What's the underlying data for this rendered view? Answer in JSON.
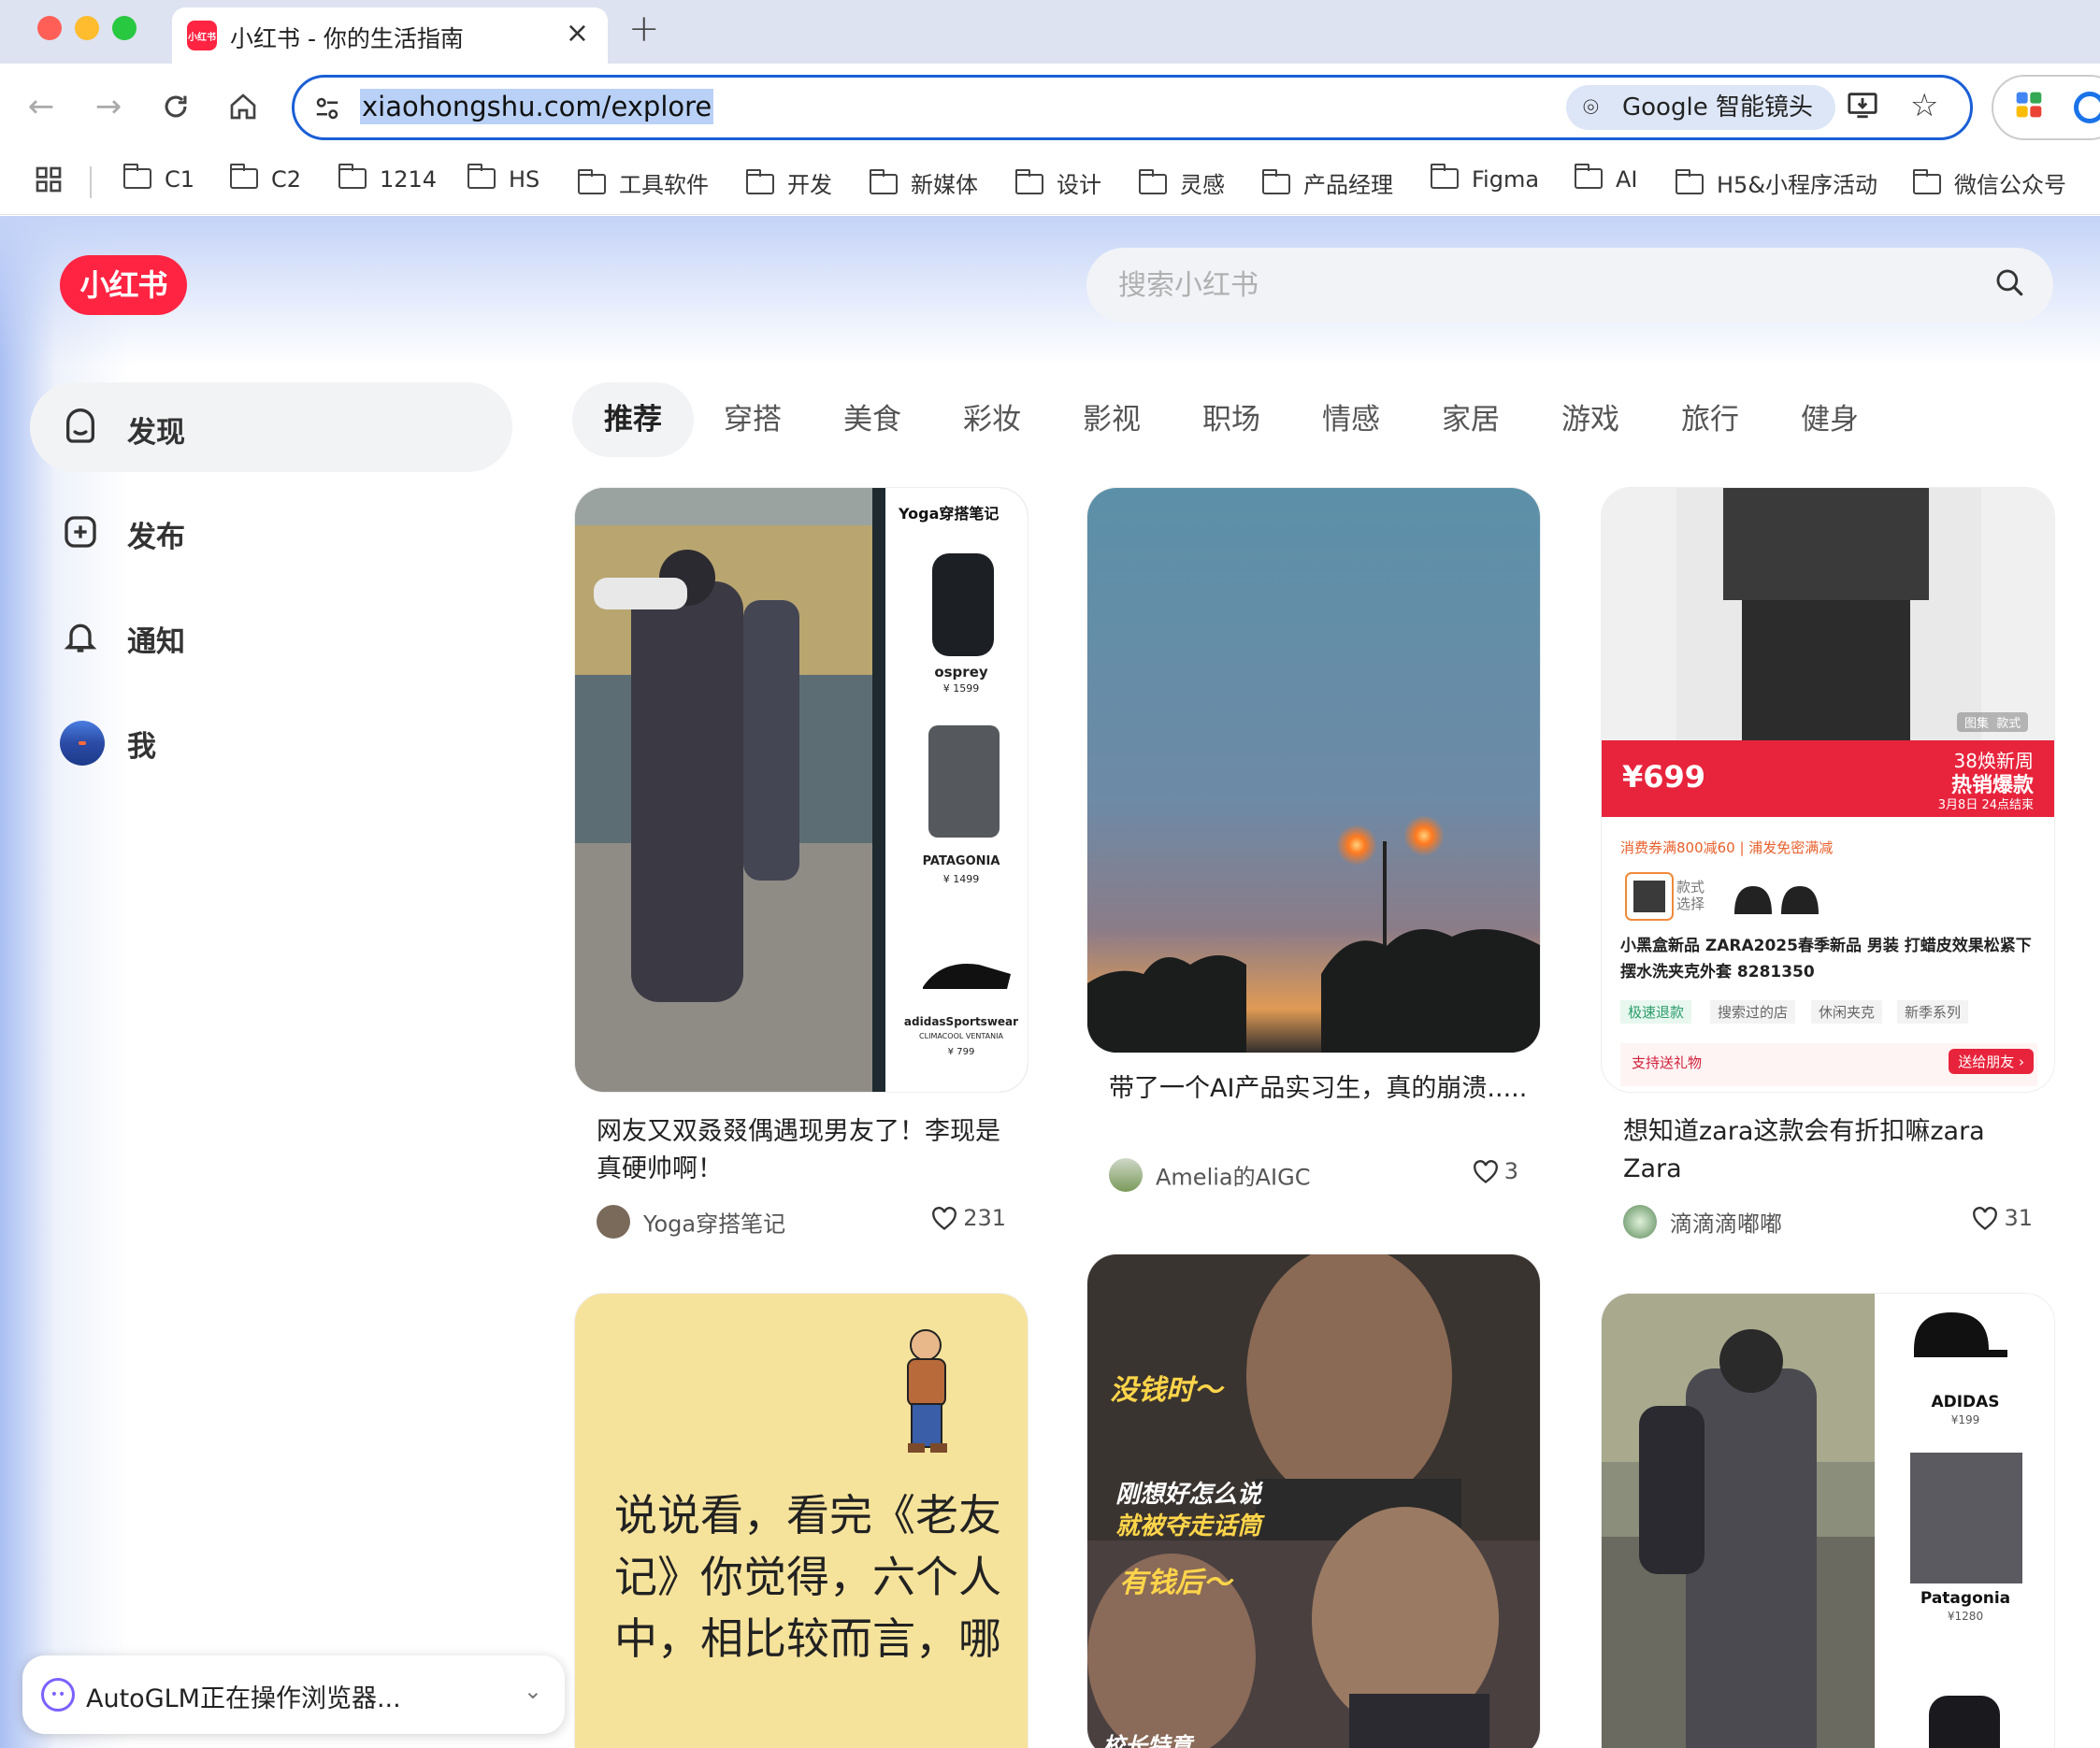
{
  "browser": {
    "tab_title": "小红书 - 你的生活指南",
    "tab_favicon_text": "小红书",
    "url": "xiaohongshu.com/explore",
    "lens_label": "Google 智能镜头",
    "bookmarks": [
      "C1",
      "C2",
      "1214",
      "HS",
      "工具软件",
      "开发",
      "新媒体",
      "设计",
      "灵感",
      "产品经理",
      "Figma",
      "AI",
      "H5&小程序活动",
      "微信公众号"
    ]
  },
  "site": {
    "logo": "小红书",
    "search_placeholder": "搜索小红书"
  },
  "sidebar": {
    "items": [
      {
        "label": "发现",
        "icon": "discover-icon"
      },
      {
        "label": "发布",
        "icon": "publish-icon"
      },
      {
        "label": "通知",
        "icon": "bell-icon"
      },
      {
        "label": "我",
        "icon": "avatar"
      }
    ]
  },
  "categories": [
    "推荐",
    "穿搭",
    "美食",
    "彩妆",
    "影视",
    "职场",
    "情感",
    "家居",
    "游戏",
    "旅行",
    "健身"
  ],
  "feed": [
    {
      "title": "网友又双叒叕偶遇现男友了！李现是真硬帅啊！",
      "author": "Yoga穿搭笔记",
      "likes": "231",
      "img_texts": {
        "badge": "Yoga穿搭笔记",
        "p1_brand": "osprey",
        "p1_price": "¥ 1599",
        "p2_brand": "PATAGONIA",
        "p2_price": "¥ 1499",
        "p3_brand": "adidasSportswear",
        "p3_sub": "CLIMACOOL VENTANIA",
        "p3_price": "¥ 799"
      }
    },
    {
      "title": "带了一个AI产品实习生，真的崩溃.....",
      "author": "Amelia的AIGC",
      "likes": "3"
    },
    {
      "title": "想知道zara这款会有折扣嘛zara Zara",
      "author": "滴滴滴嘟嘟",
      "likes": "31",
      "img_texts": {
        "price": "¥699",
        "promo_line1": "38焕新周",
        "promo_line2": "热销爆款",
        "promo_date": "3月8日 24点结束",
        "tag_gallery": "图集",
        "tag_style": "款式",
        "coupon": "消费券满800减60 | 浦发免密满减",
        "style_select": "款式选择",
        "product_name": "小黑盒新品 ZARA2025春季新品 男装 打蜡皮效果松紧下摆水洗夹克外套 8281350",
        "tags": [
          "极速退款",
          "搜索过的店",
          "休闲夹克",
          "新季系列"
        ],
        "gift": "支持送礼物",
        "gift_btn": "送给朋友 ›"
      }
    },
    {
      "img_texts": {
        "quote": "说说看，看完《老友记》你觉得，六个人中，相比较而言，哪"
      }
    },
    {
      "img_texts": {
        "line1": "没钱时～",
        "line2": "刚想好怎么说",
        "line3": "就被夺走话筒",
        "line4": "有钱后～",
        "line5": "校长特意"
      }
    },
    {
      "img_texts": {
        "b1": "ADIDAS",
        "p1": "¥199",
        "b2": "Patagonia",
        "p2": "¥1280"
      }
    }
  ],
  "autoglm": {
    "text": "AutoGLM正在操作浏览器..."
  },
  "colors": {
    "brand": "#ff2442",
    "omnibox_border": "#1a5fd6"
  }
}
